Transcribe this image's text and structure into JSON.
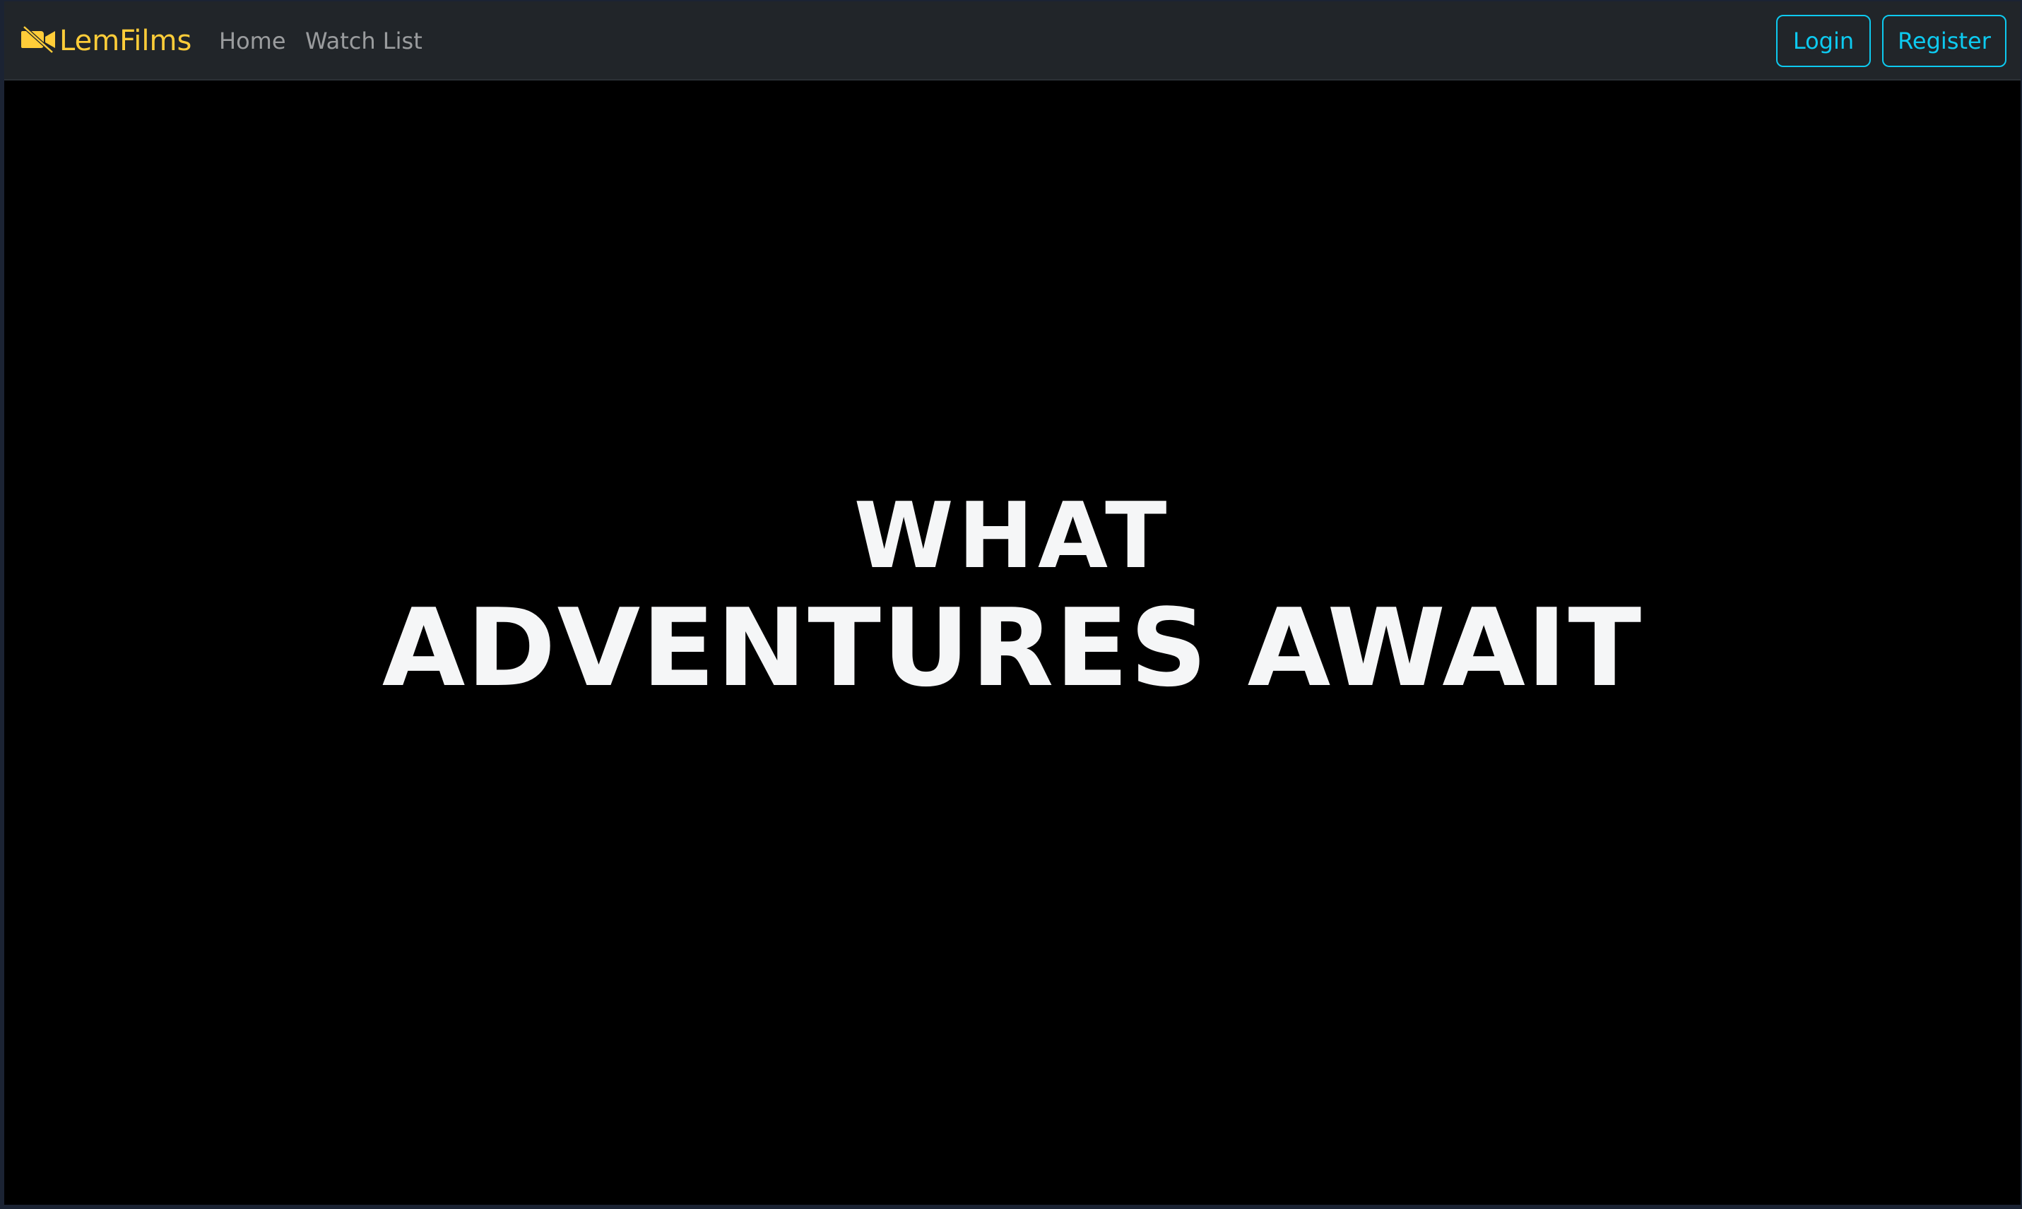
{
  "navbar": {
    "brand": "LemFilms",
    "brand_icon": "camera-video-off-icon",
    "brand_color": "#ffcd39",
    "links": [
      "Home",
      "Watch List"
    ],
    "login_label": "Login",
    "register_label": "Register",
    "accent_color": "#0dcaf0"
  },
  "hero": {
    "line1": "WHAT",
    "line2": "ADVENTURES AWAIT"
  }
}
